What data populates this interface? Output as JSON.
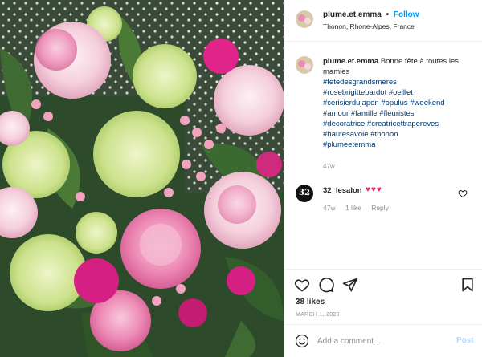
{
  "photo": {
    "description_icon": "flower-bouquet-photo"
  },
  "header": {
    "username": "plume.et.emma",
    "separator": "•",
    "follow_label": "Follow",
    "location": "Thonon, Rhone-Alpes, France"
  },
  "caption": {
    "username": "plume.et.emma",
    "text": "Bonne fête à toutes les mamies",
    "hashtags": [
      "#fetedesgrandsmeres",
      "#rosebrigittebardot #oeillet",
      "#cerisierdujapon #opulus #weekend",
      "#amour #famille #fleuristes",
      "#decoratrice #creatricettrapereves",
      "#hautesavoie #thonon",
      "#plumeetemma"
    ],
    "time": "47w"
  },
  "comment": {
    "avatar_text": "32",
    "username": "32_lesalon",
    "emoji": "♥♥♥",
    "time": "47w",
    "likes": "1 like",
    "reply": "Reply"
  },
  "actions": {
    "likes": "38 likes",
    "date": "MARCH 1, 2020"
  },
  "add_comment": {
    "placeholder": "Add a comment...",
    "post_label": "Post"
  },
  "colors": {
    "follow": "#0095f6",
    "hashtag": "#00376b",
    "muted": "#8e8e8e",
    "post_disabled": "#b3dbff"
  }
}
